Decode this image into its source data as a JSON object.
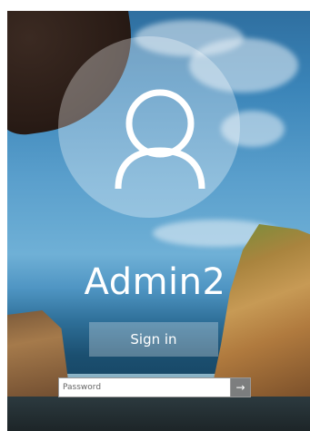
{
  "user": {
    "name": "Admin2"
  },
  "signin": {
    "label": "Sign in"
  },
  "password": {
    "placeholder": "Password",
    "submit_glyph": "→"
  },
  "icons": {
    "avatar": "user-silhouette-icon",
    "submit": "arrow-right-icon"
  },
  "colors": {
    "text": "#ffffff",
    "avatar_overlay": "rgba(255,255,255,0.32)",
    "button_overlay": "rgba(255,255,255,0.28)"
  }
}
